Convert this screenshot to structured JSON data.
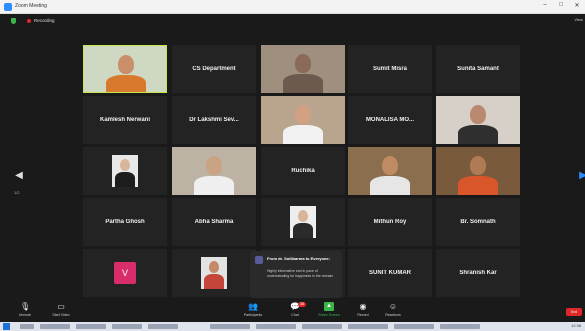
{
  "window": {
    "title": "Zoom Meeting",
    "minimize": "–",
    "maximize": "□",
    "close": "✕"
  },
  "infobar": {
    "recording_label": "Recording",
    "view_label": "View"
  },
  "gallery": {
    "page_left": "1/2",
    "page_right": "1/2",
    "tiles": [
      {
        "kind": "video",
        "label": "",
        "active": true,
        "skin": "#c98f6a",
        "cloth": "#d77a2e",
        "bg": "#cfd8c2"
      },
      {
        "kind": "name",
        "label": "CS Department"
      },
      {
        "kind": "video",
        "label": "",
        "skin": "#8a6a5a",
        "cloth": "#6d5a4e",
        "bg": "#9f8f7f"
      },
      {
        "kind": "name",
        "label": "Sumit Misra"
      },
      {
        "kind": "name",
        "label": "Sunita Samant"
      },
      {
        "kind": "name",
        "label": "Kamlesh Nerwani"
      },
      {
        "kind": "name",
        "label": "Dr Lakshmi Sev..."
      },
      {
        "kind": "video",
        "label": "",
        "skin": "#d2a184",
        "cloth": "#f2f2f2",
        "bg": "#b9a48e"
      },
      {
        "kind": "name",
        "label": "MONALISA  MO..."
      },
      {
        "kind": "video",
        "label": "",
        "skin": "#b98a70",
        "cloth": "#2f2f2f",
        "bg": "#d6d0c8"
      },
      {
        "kind": "video",
        "label": "",
        "small": true,
        "skin": "#d9b59a",
        "cloth": "#1d1d1d",
        "bg": "#e8e8e8"
      },
      {
        "kind": "video",
        "label": "",
        "skin": "#c9a383",
        "cloth": "#efefef",
        "bg": "#bdb3a4"
      },
      {
        "kind": "name",
        "label": "Ruchika"
      },
      {
        "kind": "video",
        "label": "",
        "skin": "#c08a63",
        "cloth": "#e6e6e6",
        "bg": "#8b6e4e"
      },
      {
        "kind": "video",
        "label": "",
        "skin": "#b07a55",
        "cloth": "#d9562a",
        "bg": "#7a5a3c"
      },
      {
        "kind": "name",
        "label": "Partha Ghosh"
      },
      {
        "kind": "name",
        "label": "Abha Sharma"
      },
      {
        "kind": "video",
        "label": "",
        "small": true,
        "skin": "#d9b59a",
        "cloth": "#2a2a2a",
        "bg": "#eeeeee"
      },
      {
        "kind": "name",
        "label": "Mithun Roy"
      },
      {
        "kind": "name",
        "label": "Br. Somnath"
      },
      {
        "kind": "avatar",
        "label": "",
        "letter": "V"
      },
      {
        "kind": "video",
        "label": "",
        "small": true,
        "skin": "#c48a6a",
        "cloth": "#c4453a",
        "bg": "#e3e3e3"
      },
      {
        "kind": "chat",
        "label": ""
      },
      {
        "kind": "name",
        "label": "SUNIT KUMAR"
      },
      {
        "kind": "name",
        "label": "Shranish Kar"
      }
    ]
  },
  "chat_popup": {
    "from": "From dr. Sullibarma to Everyone:",
    "message": "Highly informative and in pace of understanding for happiness in the domain"
  },
  "toolbar": {
    "unmute": "Unmute",
    "start_video": "Start Video",
    "participants": "Participants",
    "participants_count": "26",
    "chat": "Chat",
    "chat_badge": "38",
    "share_screen": "Share Screen",
    "record": "Record",
    "reactions": "Reactions",
    "end": "End"
  },
  "taskbar": {
    "clock": "12:38"
  }
}
